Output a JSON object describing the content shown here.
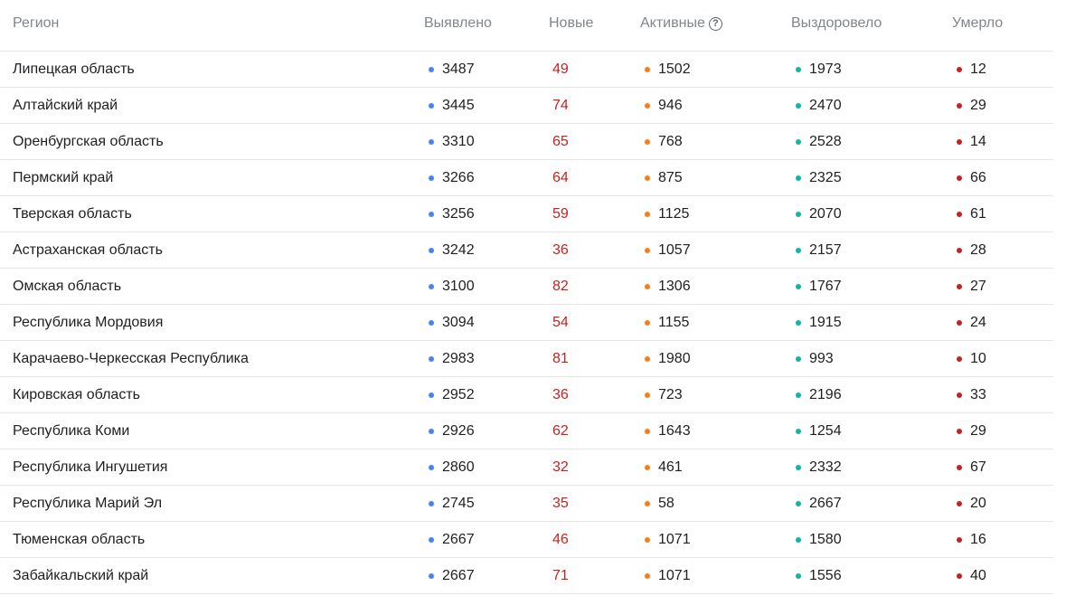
{
  "colors": {
    "found": "#4285f4",
    "active": "#fa7b17",
    "recovered": "#12b5a0",
    "dead": "#c5221f",
    "new_text": "#c5221f"
  },
  "headers": {
    "region": "Регион",
    "found": "Выявлено",
    "new": "Новые",
    "active": "Активные",
    "active_help": "?",
    "recovered": "Выздоровело",
    "dead": "Умерло"
  },
  "rows": [
    {
      "region": "Липецкая область",
      "found": "3487",
      "new": "49",
      "active": "1502",
      "recovered": "1973",
      "dead": "12"
    },
    {
      "region": "Алтайский край",
      "found": "3445",
      "new": "74",
      "active": "946",
      "recovered": "2470",
      "dead": "29"
    },
    {
      "region": "Оренбургская область",
      "found": "3310",
      "new": "65",
      "active": "768",
      "recovered": "2528",
      "dead": "14"
    },
    {
      "region": "Пермский край",
      "found": "3266",
      "new": "64",
      "active": "875",
      "recovered": "2325",
      "dead": "66"
    },
    {
      "region": "Тверская область",
      "found": "3256",
      "new": "59",
      "active": "1125",
      "recovered": "2070",
      "dead": "61"
    },
    {
      "region": "Астраханская область",
      "found": "3242",
      "new": "36",
      "active": "1057",
      "recovered": "2157",
      "dead": "28"
    },
    {
      "region": "Омская область",
      "found": "3100",
      "new": "82",
      "active": "1306",
      "recovered": "1767",
      "dead": "27"
    },
    {
      "region": "Республика Мордовия",
      "found": "3094",
      "new": "54",
      "active": "1155",
      "recovered": "1915",
      "dead": "24"
    },
    {
      "region": "Карачаево-Черкесская Республика",
      "found": "2983",
      "new": "81",
      "active": "1980",
      "recovered": "993",
      "dead": "10"
    },
    {
      "region": "Кировская область",
      "found": "2952",
      "new": "36",
      "active": "723",
      "recovered": "2196",
      "dead": "33"
    },
    {
      "region": "Республика Коми",
      "found": "2926",
      "new": "62",
      "active": "1643",
      "recovered": "1254",
      "dead": "29"
    },
    {
      "region": "Республика Ингушетия",
      "found": "2860",
      "new": "32",
      "active": "461",
      "recovered": "2332",
      "dead": "67"
    },
    {
      "region": "Республика Марий Эл",
      "found": "2745",
      "new": "35",
      "active": "58",
      "recovered": "2667",
      "dead": "20"
    },
    {
      "region": "Тюменская область",
      "found": "2667",
      "new": "46",
      "active": "1071",
      "recovered": "1580",
      "dead": "16"
    },
    {
      "region": "Забайкальский край",
      "found": "2667",
      "new": "71",
      "active": "1071",
      "recovered": "1556",
      "dead": "40"
    }
  ]
}
